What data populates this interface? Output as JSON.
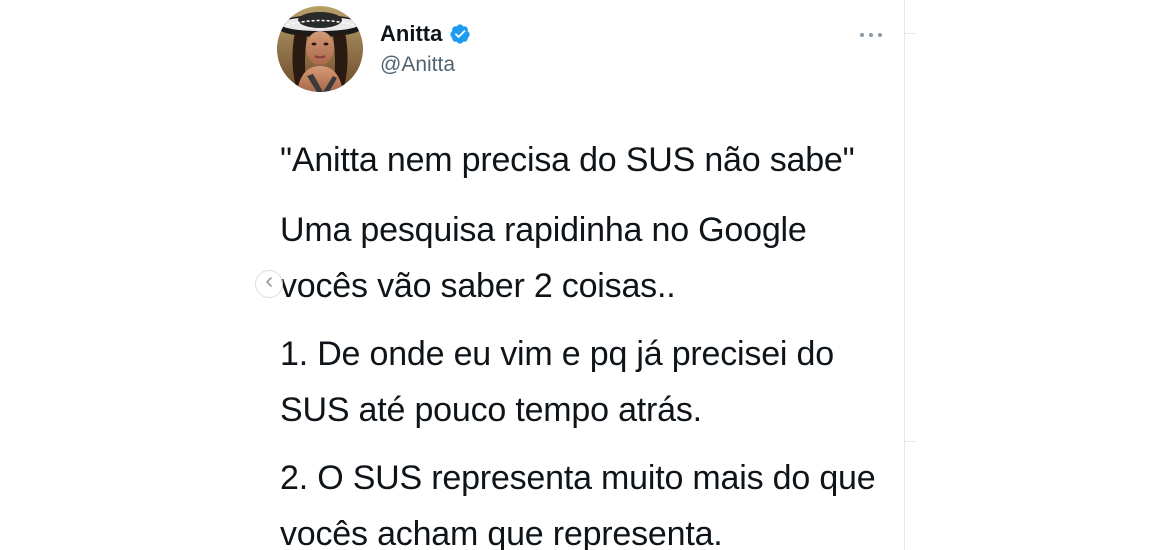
{
  "author": {
    "display_name": "Anitta",
    "handle": "@Anitta",
    "verified": true,
    "verified_icon": "verified-badge-icon"
  },
  "tweet": {
    "paragraphs": [
      "\"Anitta nem precisa do SUS não sabe\"",
      "Uma pesquisa rapidinha no Google vocês vão saber 2 coisas..",
      "1. De onde eu vim e pq já precisei do SUS até pouco tempo atrás.",
      "2. O SUS representa muito mais do que vocês acham que representa."
    ]
  },
  "icons": {
    "more": "more-options-icon",
    "carousel_prev": "chevron-left-icon"
  },
  "colors": {
    "text_primary": "#0f1419",
    "text_secondary": "#536471",
    "verified_blue": "#1d9bf0"
  }
}
